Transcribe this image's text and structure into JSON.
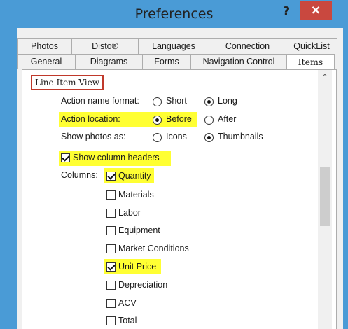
{
  "window": {
    "title": "Preferences",
    "help_glyph": "?",
    "close_glyph": "×"
  },
  "tabs_row1": [
    "Photos",
    "Disto®",
    "Languages",
    "Connection",
    "QuickList"
  ],
  "tabs_row2": [
    "General",
    "Diagrams",
    "Forms",
    "Navigation Control",
    "Items"
  ],
  "active_tab": "Items",
  "group": {
    "label": "Line Item View"
  },
  "action_name_format": {
    "label": "Action name format:",
    "options": [
      "Short",
      "Long"
    ],
    "selected": "Long"
  },
  "action_location": {
    "label": "Action location:",
    "options": [
      "Before",
      "After"
    ],
    "selected": "Before"
  },
  "show_photos_as": {
    "label": "Show photos as:",
    "options": [
      "Icons",
      "Thumbnails"
    ],
    "selected": "Thumbnails"
  },
  "show_column_headers": {
    "label": "Show column headers",
    "checked": true
  },
  "columns": {
    "label": "Columns:",
    "items": [
      {
        "label": "Quantity",
        "checked": true
      },
      {
        "label": "Materials",
        "checked": false
      },
      {
        "label": "Labor",
        "checked": false
      },
      {
        "label": "Equipment",
        "checked": false
      },
      {
        "label": "Market Conditions",
        "checked": false
      },
      {
        "label": "Unit Price",
        "checked": true
      },
      {
        "label": "Depreciation",
        "checked": false
      },
      {
        "label": "ACV",
        "checked": false
      },
      {
        "label": "Total",
        "checked": false
      }
    ]
  },
  "scrollbar": {
    "up_glyph": "^"
  },
  "colors": {
    "titlebar": "#4a9bd6",
    "close": "#c9483f",
    "highlight": "#ffff33",
    "group_border": "#c0392b"
  }
}
